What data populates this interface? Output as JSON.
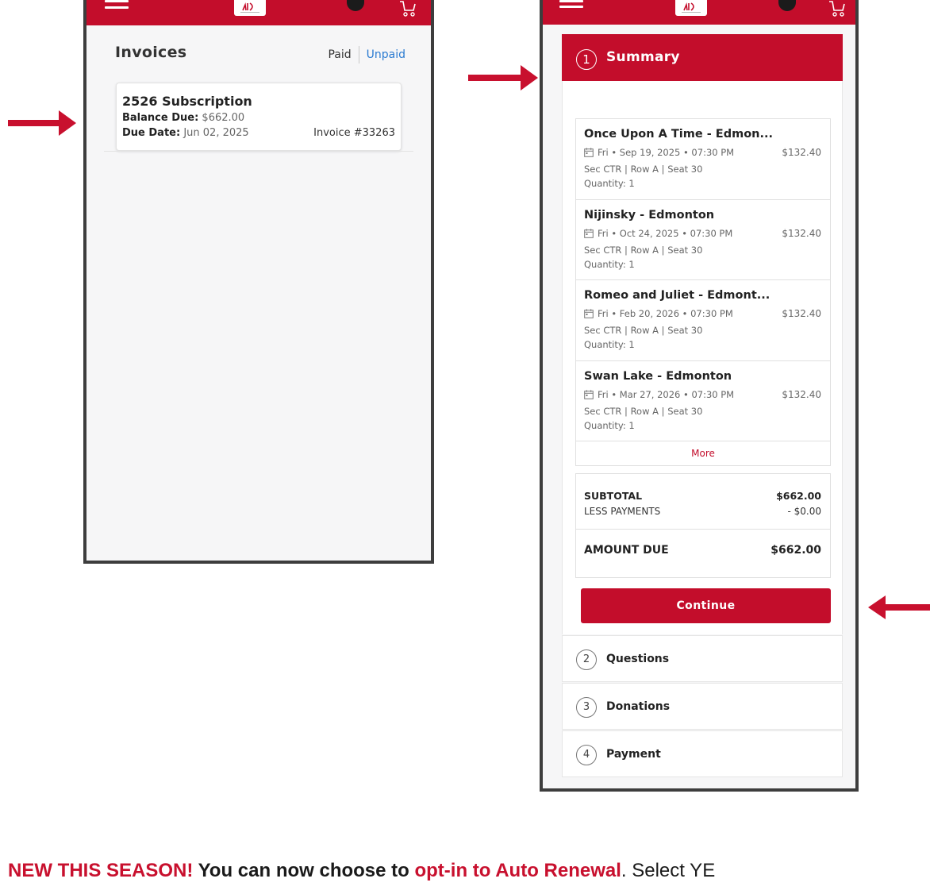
{
  "brand": {
    "accent": "#c30d2b",
    "arrow_color": "#c8102e",
    "link_color": "#2b7bd1"
  },
  "invoices": {
    "title": "Invoices",
    "tabs": {
      "paid": "Paid",
      "unpaid": "Unpaid"
    },
    "card": {
      "name": "2526 Subscription",
      "balance_label": "Balance Due:",
      "balance_value": "$662.00",
      "due_label": "Due Date:",
      "due_value": "Jun 02, 2025",
      "invoice_number": "Invoice #33263"
    }
  },
  "checkout": {
    "summary": {
      "step": "1",
      "label": "Summary"
    },
    "items": [
      {
        "title": "Once Upon A Time - Edmon...",
        "date": "Fri • Sep 19, 2025 • 07:30 PM",
        "price": "$132.40",
        "seat": "Sec CTR | Row A  |  Seat 30",
        "quantity": "Quantity: 1"
      },
      {
        "title": "Nijinsky - Edmonton",
        "date": "Fri • Oct 24, 2025 • 07:30 PM",
        "price": "$132.40",
        "seat": "Sec CTR | Row A  |  Seat 30",
        "quantity": "Quantity: 1"
      },
      {
        "title": "Romeo and Juliet - Edmont...",
        "date": "Fri • Feb 20, 2026 • 07:30 PM",
        "price": "$132.40",
        "seat": "Sec CTR | Row A  |  Seat 30",
        "quantity": "Quantity: 1"
      },
      {
        "title": "Swan Lake - Edmonton",
        "date": "Fri • Mar 27, 2026 • 07:30 PM",
        "price": "$132.40",
        "seat": "Sec CTR | Row A  |  Seat 30",
        "quantity": "Quantity: 1"
      }
    ],
    "more_label": "More",
    "totals": {
      "subtotal_label": "SUBTOTAL",
      "subtotal_value": "$662.00",
      "payments_label": "LESS PAYMENTS",
      "payments_value": "- $0.00",
      "amount_due_label": "AMOUNT DUE",
      "amount_due_value": "$662.00"
    },
    "continue_label": "Continue",
    "steps": [
      {
        "number": "2",
        "label": "Questions"
      },
      {
        "number": "3",
        "label": "Donations"
      },
      {
        "number": "4",
        "label": "Payment"
      }
    ]
  },
  "caption": {
    "part1": "NEW THIS SEASON!",
    "part2": " You can now choose to ",
    "part3": "opt-in to Auto Renewal",
    "part4": ". Select YE"
  }
}
